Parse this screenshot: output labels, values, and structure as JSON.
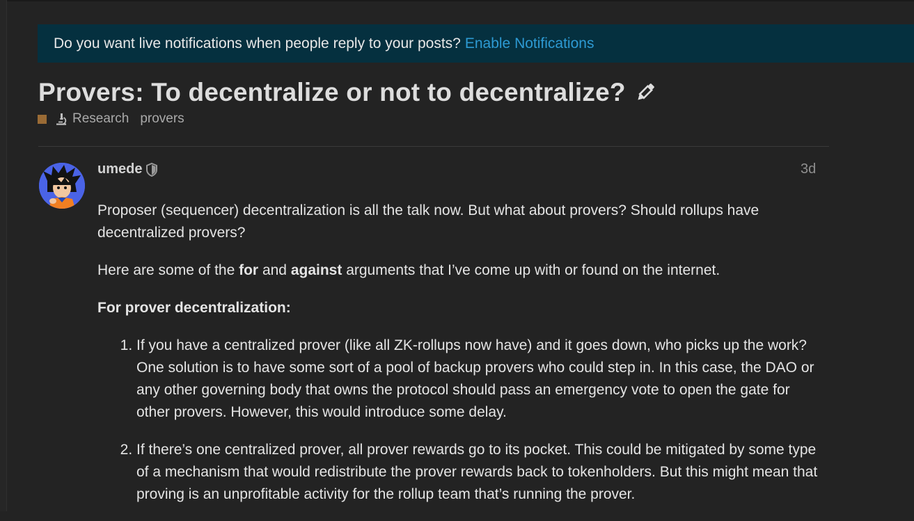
{
  "banner": {
    "text": "Do you want live notifications when people reply to your posts?",
    "link": "Enable Notifications"
  },
  "topic": {
    "title": "Provers: To decentralize or not to decentralize?",
    "category": "Research",
    "category_color": "#9a6b35",
    "tag": "provers"
  },
  "post": {
    "username": "umede",
    "date": "3d",
    "p1": "Proposer (sequencer) decentralization is all the talk now. But what about provers? Should rollups have decentralized provers?",
    "p2_before": "Here are some of the ",
    "p2_for": "for",
    "p2_and": " and ",
    "p2_against": "against",
    "p2_after": " arguments that I’ve come up with or found on the internet.",
    "heading": "For prover decentralization:",
    "items": [
      "If you have a centralized prover (like all ZK-rollups now have) and it goes down, who picks up the work? One solution is to have some sort of a pool of backup provers who could step in. In this case, the DAO or any other governing body that owns the protocol should pass an emergency vote to open the gate for other provers. However, this would introduce some delay.",
      "If there’s one centralized prover, all prover rewards go to its pocket. This could be mitigated by some type of a mechanism that would redistribute the prover rewards back to tokenholders. But this might mean that proving is an unprofitable activity for the rollup team that’s running the prover."
    ]
  },
  "icons": {
    "edit": "pencil-icon",
    "category": "microscope-icon",
    "badge": "shield-icon"
  }
}
